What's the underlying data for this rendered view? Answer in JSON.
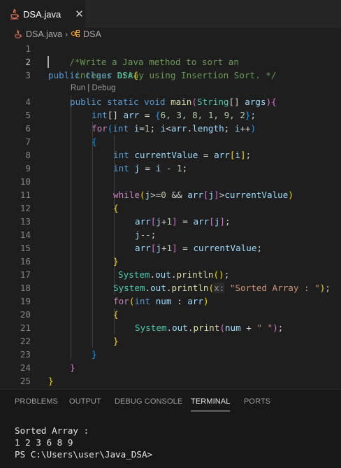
{
  "tab": {
    "filename": "DSA.java",
    "close_glyph": "✕",
    "icon": "java-icon"
  },
  "breadcrumb": {
    "file": "DSA.java",
    "separator": "›",
    "symbol": "DSA",
    "symbol_icon": "class-icon"
  },
  "editor": {
    "line_numbers": [
      "1",
      "2",
      "3",
      "4",
      "5",
      "6",
      "7",
      "8",
      "9",
      "10",
      "11",
      "12",
      "13",
      "14",
      "15",
      "16",
      "17",
      "18",
      "19",
      "20",
      "21",
      "22",
      "23",
      "24",
      "25"
    ],
    "active_line": 2,
    "codelens": "Run | Debug",
    "lines": {
      "l1": "/*Write a Java method to sort an",
      "l2": "integer array using Insertion Sort. */",
      "l3_kw": "public class ",
      "l3_name": "DSA",
      "l3_brace": "{",
      "l4_kw": "public static void ",
      "l4_fn": "main",
      "l4_paren_open": "(",
      "l4_type": "String",
      "l4_arr": "[] ",
      "l4_arg": "args",
      "l4_paren_close": ")",
      "l4_brace": "{",
      "l5_kw": "int",
      "l5_b": "[] ",
      "l5_var": "arr",
      "l5_eq": " = ",
      "l5_open": "{",
      "l5_nums": "6, 3, 8, 1, 9, 2",
      "l5_close": "}",
      "l5_end": ";",
      "l6_kw": "for",
      "l6_open": "(",
      "l6_int": "int ",
      "l6_i": "i",
      "l6_eq": "=",
      "l6_one": "1",
      "l6_mid": "; ",
      "l6_i2": "i",
      "l6_lt": "<",
      "l6_arr": "arr",
      "l6_dot": ".",
      "l6_len": "length",
      "l6_semi": "; ",
      "l6_i3": "i",
      "l6_inc": "++",
      "l6_close": ")",
      "l7": "{",
      "l8_kw": "int ",
      "l8_var": "currentValue",
      "l8_eq": " = ",
      "l8_arr": "arr",
      "l8_ob": "[",
      "l8_i": "i",
      "l8_cb": "]",
      "l8_end": ";",
      "l9_kw": "int ",
      "l9_var": "j",
      "l9_eq": " = ",
      "l9_i": "i",
      "l9_minus": " - ",
      "l9_one": "1",
      "l9_end": ";",
      "l11_kw": "while",
      "l11_open": "(",
      "l11_j": "j",
      "l11_ge": ">=",
      "l11_zero": "0",
      "l11_and": " && ",
      "l11_arr": "arr",
      "l11_ob": "[",
      "l11_j2": "j",
      "l11_cb": "]",
      "l11_gt": ">",
      "l11_cv": "currentValue",
      "l11_close": ")",
      "l12": "{",
      "l13_arr": "arr",
      "l13_ob": "[",
      "l13_j": "j",
      "l13_plus": "+",
      "l13_one": "1",
      "l13_cb": "]",
      "l13_eq": " = ",
      "l13_arr2": "arr",
      "l13_ob2": "[",
      "l13_j2": "j",
      "l13_cb2": "]",
      "l13_end": ";",
      "l14_j": "j",
      "l14_dec": "--;",
      "l15_arr": "arr",
      "l15_ob": "[",
      "l15_j": "j",
      "l15_plus": "+",
      "l15_one": "1",
      "l15_cb": "]",
      "l15_eq": " = ",
      "l15_cv": "currentValue",
      "l15_end": ";",
      "l16": "}",
      "l17_sys": "System",
      "l17_dot": ".",
      "l17_out": "out",
      "l17_dot2": ".",
      "l17_fn": "println",
      "l17_paren": "()",
      "l17_end": ";",
      "l18_sys": "System",
      "l18_dot": ".",
      "l18_out": "out",
      "l18_dot2": ".",
      "l18_fn": "println",
      "l18_open": "(",
      "l18_hint": "x:",
      "l18_str": "\"Sorted Array : \"",
      "l18_close": ")",
      "l18_end": ";",
      "l19_kw": "for",
      "l19_open": "(",
      "l19_int": "int ",
      "l19_num": "num",
      "l19_colon": " : ",
      "l19_arr": "arr",
      "l19_close": ")",
      "l20": "{",
      "l21_sys": "System",
      "l21_dot": ".",
      "l21_out": "out",
      "l21_dot2": ".",
      "l21_fn": "print",
      "l21_open": "(",
      "l21_num": "num",
      "l21_plus": " + ",
      "l21_str": "\" \"",
      "l21_close": ")",
      "l21_end": ";",
      "l22": "}",
      "l23": "}",
      "l24": "}",
      "l25": "}"
    }
  },
  "panel": {
    "tabs": [
      "PROBLEMS",
      "OUTPUT",
      "DEBUG CONSOLE",
      "TERMINAL",
      "PORTS"
    ],
    "active_tab": "TERMINAL",
    "terminal_lines": [
      "Sorted Array :",
      "1 2 3 6 8 9",
      "PS C:\\Users\\user\\Java_DSA>"
    ]
  },
  "colors": {
    "background": "#1e1e1e",
    "comment": "#6a9955",
    "keyword": "#569cd6",
    "control": "#c586c0",
    "type": "#4ec9b0",
    "function": "#dcdcaa",
    "variable": "#9cdcfe",
    "number": "#b5cea8",
    "string": "#ce9178"
  }
}
